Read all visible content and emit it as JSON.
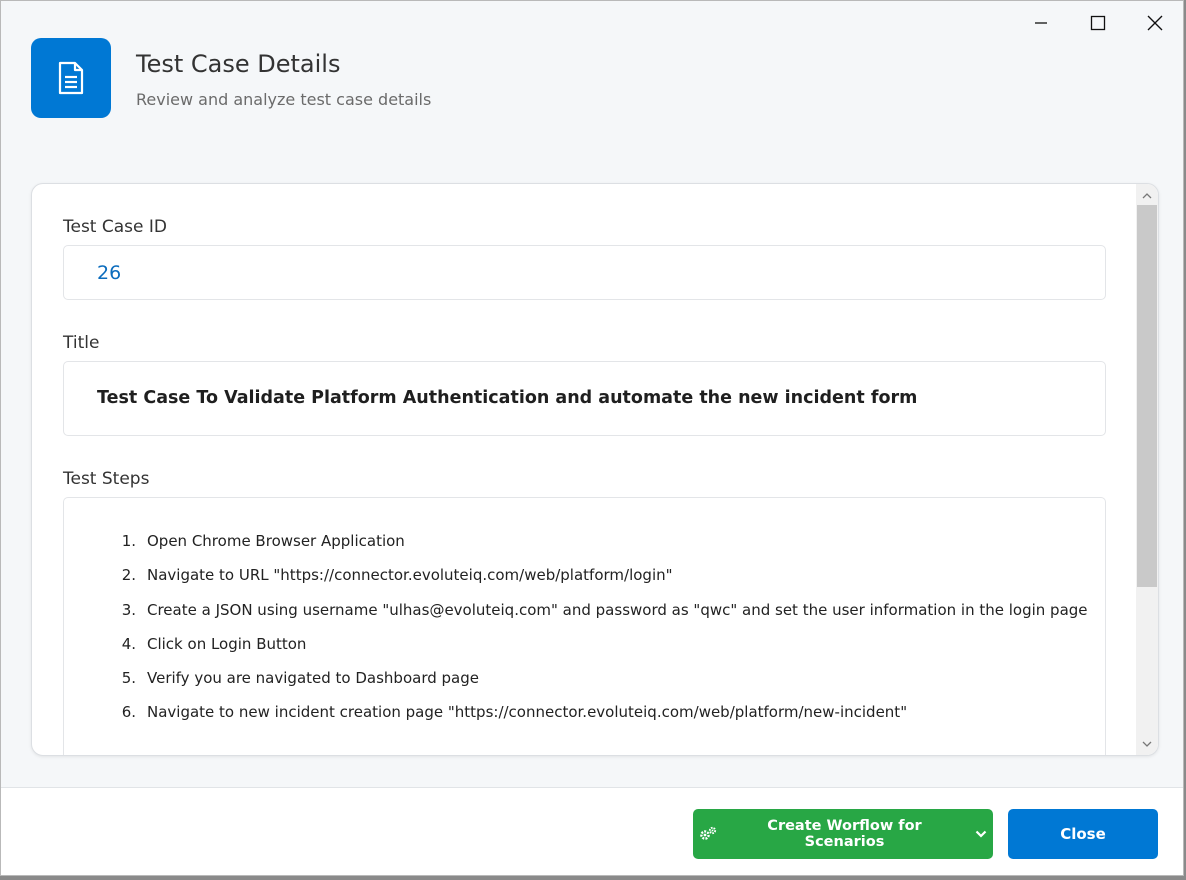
{
  "header": {
    "title": "Test Case Details",
    "subtitle": "Review and analyze test case details",
    "icon": "document-icon",
    "accent_color": "#0078d4"
  },
  "window_controls": [
    "minimize-icon",
    "maximize-icon",
    "close-icon"
  ],
  "fields": {
    "id_label": "Test Case ID",
    "id_value": "26",
    "title_label": "Title",
    "title_value": "Test Case To Validate Platform Authentication and automate the new incident form",
    "steps_label": "Test Steps",
    "steps": [
      {
        "num": "1.",
        "text": "Open Chrome Browser Application"
      },
      {
        "num": "2.",
        "text": "Navigate to URL \"https://connector.evoluteiq.com/web/platform/login\""
      },
      {
        "num": "3.",
        "text": "Create a JSON using username \"ulhas@evoluteiq.com\" and password as \"qwc\" and set the user information in the login page"
      },
      {
        "num": "4.",
        "text": "Click on Login Button"
      },
      {
        "num": "5.",
        "text": "Verify you are navigated to Dashboard page"
      },
      {
        "num": "6.",
        "text": "Navigate to new incident creation page \"https://connector.evoluteiq.com/web/platform/new-incident\""
      }
    ]
  },
  "footer": {
    "workflow_button": "Create Worflow for Scenarios",
    "workflow_color": "#28a745",
    "close_button": "Close",
    "close_color": "#0078d4"
  }
}
